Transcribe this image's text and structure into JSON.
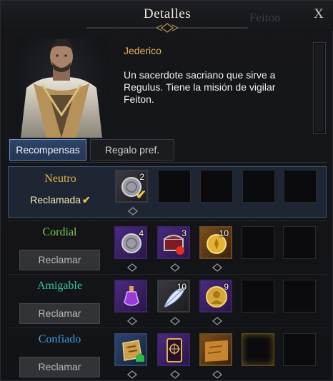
{
  "window": {
    "title": "Detalles",
    "close_glyph": "X",
    "background_label": "Feiton"
  },
  "npc": {
    "name": "Jederico",
    "description": "Un sacerdote sacriano que sirve a Regulus. Tiene la misión de vigilar Feiton."
  },
  "tabs": [
    {
      "label": "Recompensas",
      "active": true
    },
    {
      "label": "Regalo pref.",
      "active": false
    }
  ],
  "tiers": [
    {
      "name": "Neutro",
      "color": "#e3b24a",
      "status": "Reclamada",
      "check": "✔",
      "rewards": [
        {
          "icon": "silver-coin-icon",
          "qty": "2",
          "claimed": true
        }
      ]
    },
    {
      "name": "Cordial",
      "color": "#7ec84a",
      "button": "Reclamar",
      "rewards": [
        {
          "icon": "silver-coin-icon",
          "qty": "4"
        },
        {
          "icon": "treasure-chest-icon",
          "qty": "3"
        },
        {
          "icon": "gold-coin-icon",
          "qty": "10"
        }
      ]
    },
    {
      "name": "Amigable",
      "color": "#2fc9a2",
      "button": "Reclamar",
      "rewards": [
        {
          "icon": "potion-icon",
          "qty": ""
        },
        {
          "icon": "feather-icon",
          "qty": "10"
        },
        {
          "icon": "gold-medal-icon",
          "qty": "9"
        }
      ]
    },
    {
      "name": "Confiado",
      "color": "#3aa0e8",
      "button": "Reclamar",
      "rewards": [
        {
          "icon": "map-icon",
          "qty": ""
        },
        {
          "icon": "card-icon",
          "qty": ""
        },
        {
          "icon": "scroll-icon",
          "qty": ""
        }
      ]
    }
  ]
}
